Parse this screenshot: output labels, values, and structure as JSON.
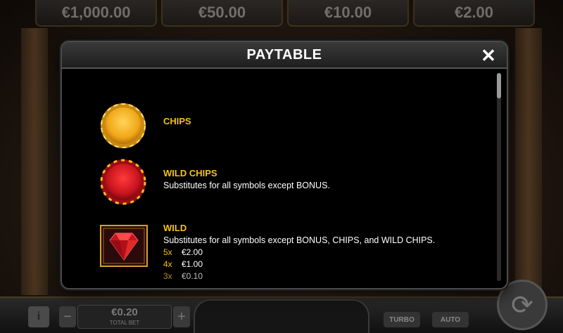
{
  "background": {
    "jackpots": [
      "€1,000.00",
      "€50.00",
      "€10.00",
      "€2.00"
    ],
    "bottom_bar": {
      "info_label": "i",
      "minus_label": "−",
      "plus_label": "+",
      "bet_value": "€0.20",
      "bet_label": "TOTAL BET",
      "turbo_label": "TURBO",
      "auto_label": "AUTO",
      "spin_icon": "refresh-icon"
    }
  },
  "paytable": {
    "title": "PAYTABLE",
    "close_label": "✕",
    "symbols": [
      {
        "name": "CHIPS",
        "icon": "gold-chip-icon",
        "description": "",
        "pays": []
      },
      {
        "name": "WILD CHIPS",
        "icon": "red-chip-icon",
        "description": "Substitutes for all symbols except BONUS.",
        "pays": []
      },
      {
        "name": "WILD",
        "icon": "ruby-gem-icon",
        "description": "Substitutes for all symbols except BONUS, CHIPS, and WILD CHIPS.",
        "pays": [
          {
            "mult": "5x",
            "amount": "€2.00"
          },
          {
            "mult": "4x",
            "amount": "€1.00"
          },
          {
            "mult": "3x",
            "amount": "€0.10"
          }
        ]
      }
    ]
  },
  "colors": {
    "accent_gold": "#f5c01a",
    "chip_gold": "#f0a818",
    "chip_red": "#c8141e",
    "modal_bg": "#000000"
  }
}
